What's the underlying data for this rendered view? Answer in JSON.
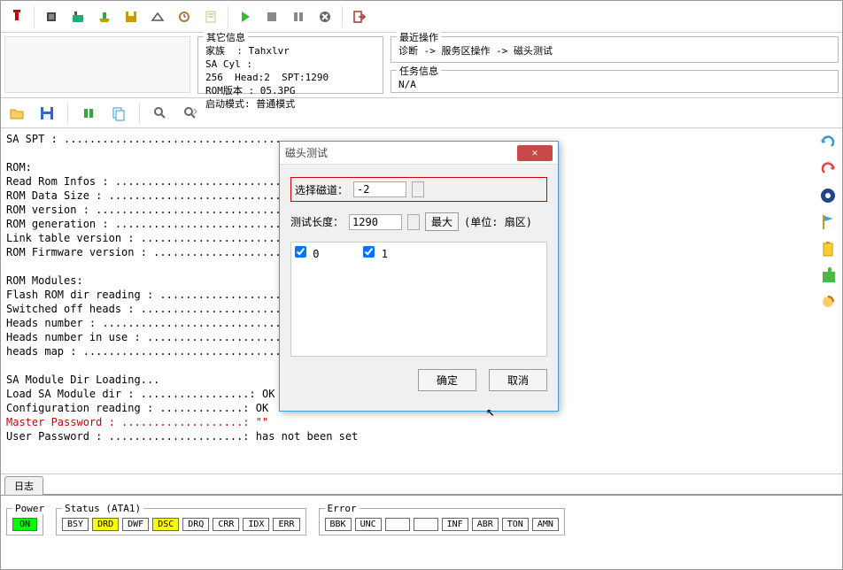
{
  "toolbar": {
    "icons": [
      "pin",
      "chip",
      "pcb",
      "tray",
      "disk",
      "scan",
      "clock",
      "note",
      "play",
      "stop",
      "pause",
      "cancel",
      "exit"
    ]
  },
  "info": {
    "other_title": "其它信息",
    "family_label": "家族",
    "family_value": "Tahxlvr",
    "sa_cyl_label": "SA Cyl",
    "sa_cyl_value": "256",
    "head_label": "Head:2",
    "spt_label": "SPT:1290",
    "rom_ver_label": "ROM版本",
    "rom_ver_value": "05.3PG",
    "boot_mode_label": "启动模式",
    "boot_mode_value": "普通模式",
    "recent_title": "最近操作",
    "recent_value": "诊断 -> 服务区操作 -> 磁头测试",
    "task_title": "任务信息",
    "task_value": "N/A"
  },
  "log": {
    "lines": [
      "SA SPT : ........................................",
      "",
      "ROM:",
      "Read Rom Infos : ................................",
      "ROM Data Size : .................................",
      "ROM version : ...................................",
      "ROM generation : ................................",
      "Link table version : ............................",
      "ROM Firmware version : ..........................",
      "",
      "ROM Modules:",
      "Flash ROM dir reading : .........................",
      "Switched off heads : ............................",
      "Heads number : ..................................",
      "Heads number in use : ...........................",
      "heads map : .....................................",
      "",
      "SA Module Dir Loading...",
      "Load SA Module dir : .................: OK",
      "Configuration reading : .............: OK"
    ],
    "master_pw": "Master Password : ...................: \"\"",
    "user_pw": "User Password : .....................: has not been set"
  },
  "dialog": {
    "title": "磁头测试",
    "select_track": "选择磁道：",
    "track_value": "-2",
    "test_len": "测试长度：",
    "len_value": "1290",
    "max_btn": "最大",
    "unit": "(单位: 扇区)",
    "chk0": "0",
    "chk1": "1",
    "ok": "确定",
    "cancel": "取消"
  },
  "tab": {
    "label": "日志"
  },
  "status": {
    "power": "Power",
    "on": "ON",
    "ata_title": "Status (ATA1)",
    "ata": [
      "BSY",
      "DRD",
      "DWF",
      "DSC",
      "DRQ",
      "CRR",
      "IDX",
      "ERR"
    ],
    "error_title": "Error",
    "error": [
      "BBK",
      "UNC",
      "",
      "",
      "INF",
      "ABR",
      "TON",
      "AMN"
    ]
  }
}
